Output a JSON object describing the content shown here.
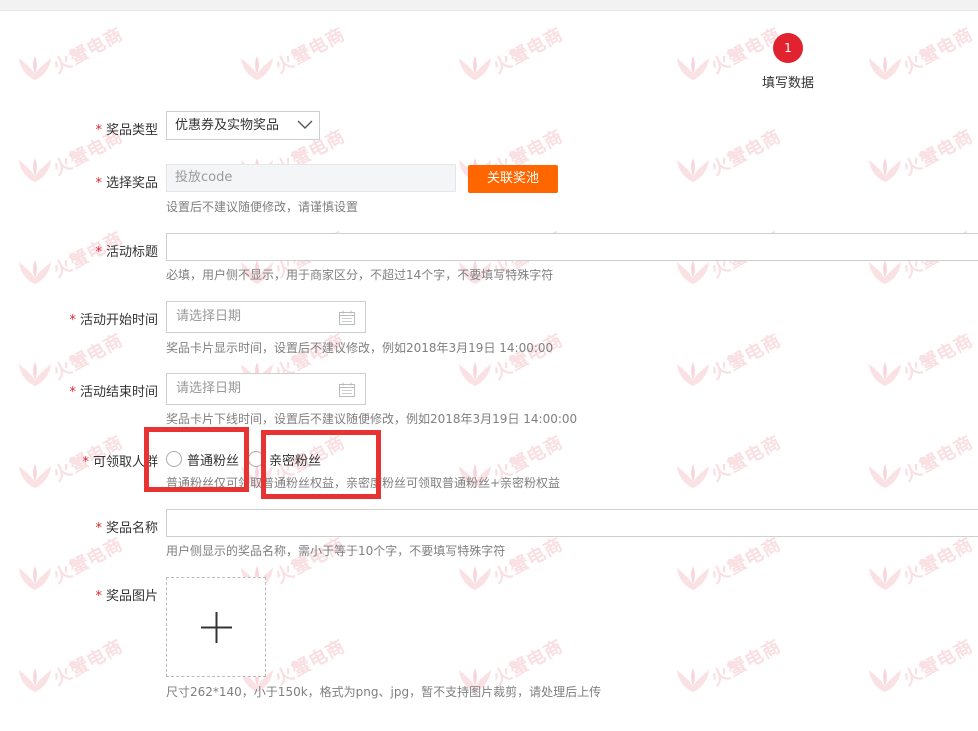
{
  "watermark": {
    "brand_text": "火蟹电商"
  },
  "step": {
    "number": "1",
    "label": "填写数据"
  },
  "form": {
    "prize_type": {
      "label": "奖品类型",
      "value": "优惠券及实物奖品"
    },
    "choose_prize": {
      "label": "选择奖品",
      "placeholder": "投放code",
      "button": "关联奖池",
      "hint": "设置后不建议随便修改，请谨慎设置"
    },
    "activity_title": {
      "label": "活动标题",
      "hint": "必填，用户侧不显示，用于商家区分，不超过14个字，不要填写特殊字符"
    },
    "start_time": {
      "label": "活动开始时间",
      "placeholder": "请选择日期",
      "hint": "奖品卡片显示时间，设置后不建议修改，例如2018年3月19日 14:00:00"
    },
    "end_time": {
      "label": "活动结束时间",
      "placeholder": "请选择日期",
      "hint": "奖品卡片下线时间，设置后不建议随便修改，例如2018年3月19日 14:00:00"
    },
    "audience": {
      "label": "可领取人群",
      "options": [
        "普通粉丝",
        "亲密粉丝"
      ],
      "hint": "普通粉丝仅可领取普通粉丝权益，亲密度粉丝可领取普通粉丝+亲密粉权益"
    },
    "prize_name": {
      "label": "奖品名称",
      "hint": "用户侧显示的奖品名称，需小于等于10个字，不要填写特殊字符"
    },
    "prize_image": {
      "label": "奖品图片",
      "hint": "尺寸262*140，小于150k，格式为png、jpg，暂不支持图片裁剪，请处理后上传"
    }
  },
  "required_mark": "*",
  "colors": {
    "accent_red": "#e0232f",
    "button_orange": "#ff6600",
    "highlight_red": "#e83333"
  },
  "icons": [
    "chevron-down-icon",
    "calendar-icon",
    "plus-icon",
    "watermark-logo-icon"
  ]
}
